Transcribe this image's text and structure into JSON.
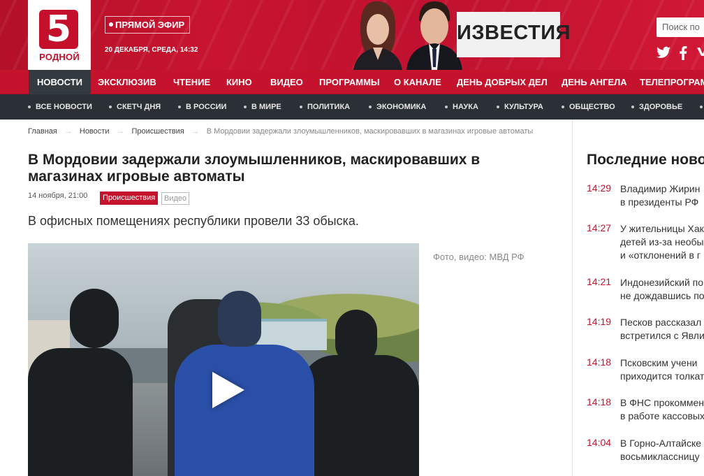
{
  "header": {
    "logo_number": "5",
    "logo_text": "РОДНОЙ",
    "live_label": "ПРЯМОЙ ЭФИР",
    "date": "20 ДЕКАБРЯ, СРЕДА, 14:32",
    "promo_label": "ИЗВЕСТИЯ",
    "search_placeholder": "Поиск по",
    "social": [
      "twitter-icon",
      "facebook-icon",
      "vk-icon"
    ],
    "accent_color": "#c5122d"
  },
  "nav": {
    "items": [
      "НОВОСТИ",
      "ЭКСКЛЮЗИВ",
      "ЧТЕНИЕ",
      "КИНО",
      "ВИДЕО",
      "ПРОГРАММЫ",
      "О КАНАЛЕ",
      "ДЕНЬ ДОБРЫХ ДЕЛ",
      "ДЕНЬ АНГЕЛА",
      "ТЕЛЕПРОГРАММА"
    ],
    "active": "НОВОСТИ"
  },
  "subnav": {
    "items": [
      "ВСЕ НОВОСТИ",
      "СКЕТЧ ДНЯ",
      "В РОССИИ",
      "В МИРЕ",
      "ПОЛИТИКА",
      "ЭКОНОМИКА",
      "НАУКА",
      "КУЛЬТУРА",
      "ОБЩЕСТВО",
      "ЗДОРОВЬЕ"
    ]
  },
  "breadcrumb": {
    "items": [
      "Главная",
      "Новости",
      "Происшествия"
    ],
    "current": "В Мордовии задержали злоумышленников, маскировавших в магазинах игровые автоматы",
    "separator": "→"
  },
  "article": {
    "title": "В Мордовии задержали злоумышленников, маскировавших в магазинах игровые автоматы",
    "date": "14 ноября, 21:00",
    "tag": "Происшествия",
    "tag2": "Видео",
    "lead": "В офисных помещениях республики провели 33 обыска.",
    "photo_credit": "Фото, видео: МВД РФ"
  },
  "sidebar": {
    "title": "Последние ново",
    "news": [
      {
        "time": "14:29",
        "lines": [
          "Владимир Жирин",
          "в президенты РФ"
        ]
      },
      {
        "time": "14:27",
        "lines": [
          "У жительницы Хак",
          "детей из-за необы",
          "и «отклонений в г"
        ]
      },
      {
        "time": "14:21",
        "lines": [
          "Индонезийский по",
          "не дождавшись по"
        ]
      },
      {
        "time": "14:19",
        "lines": [
          "Песков рассказал",
          "встретился с Явли"
        ]
      },
      {
        "time": "14:18",
        "lines": [
          "Псковским учени",
          "приходится толкат"
        ]
      },
      {
        "time": "14:18",
        "lines": [
          "В ФНС прокоммен",
          "в работе кассовых"
        ]
      },
      {
        "time": "14:04",
        "lines": [
          "В Горно-Алтайске",
          "восьмиклассницу"
        ]
      }
    ]
  }
}
